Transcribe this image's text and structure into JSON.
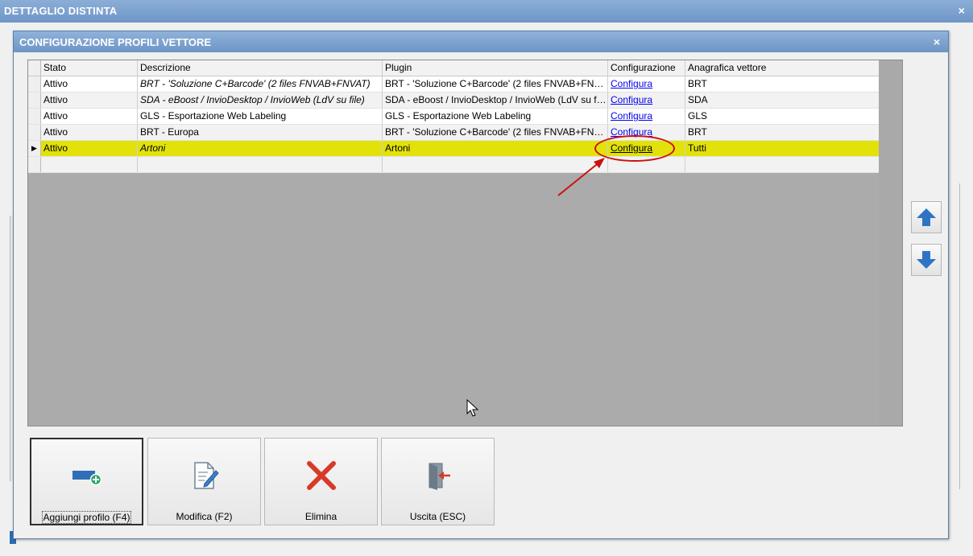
{
  "outer_window": {
    "title": "DETTAGLIO DISTINTA",
    "close_glyph": "×"
  },
  "dialog": {
    "title": "CONFIGURAZIONE PROFILI VETTORE",
    "close_glyph": "×"
  },
  "grid": {
    "columns": [
      "Stato",
      "Descrizione",
      "Plugin",
      "Configurazione",
      "Anagrafica vettore"
    ],
    "rows": [
      {
        "stato": "Attivo",
        "descrizione": "BRT - 'Soluzione C+Barcode' (2 files FNVAB+FNVAT)",
        "plugin": "BRT - 'Soluzione C+Barcode' (2 files FNVAB+FNVAT)",
        "configurazione": "Configura",
        "anagrafica": "BRT",
        "italic": true
      },
      {
        "stato": "Attivo",
        "descrizione": "SDA - eBoost / InvioDesktop / InvioWeb (LdV su file)",
        "plugin": "SDA - eBoost / InvioDesktop / InvioWeb (LdV su file)",
        "configurazione": "Configura",
        "anagrafica": "SDA",
        "italic": true
      },
      {
        "stato": "Attivo",
        "descrizione": "GLS - Esportazione Web Labeling",
        "plugin": "GLS - Esportazione Web Labeling",
        "configurazione": "Configura",
        "anagrafica": "GLS",
        "italic": false
      },
      {
        "stato": "Attivo",
        "descrizione": "BRT - Europa",
        "plugin": "BRT - 'Soluzione C+Barcode' (2 files FNVAB+FNVAT)",
        "configurazione": "Configura",
        "anagrafica": "BRT",
        "italic": false
      },
      {
        "stato": "Attivo",
        "descrizione": "Artoni",
        "plugin": "Artoni",
        "configurazione": "Configura",
        "anagrafica": "Tutti",
        "italic": true,
        "selected": true
      }
    ],
    "row_indicator_glyph": "▶"
  },
  "buttons": {
    "add": "Aggiungi profilo (F4)",
    "edit": "Modifica (F2)",
    "delete": "Elimina",
    "exit": "Uscita (ESC)"
  },
  "colors": {
    "selected_row": "#e2e20a",
    "link": "#0000ee",
    "annotation": "#cc1010",
    "arrow_blue": "#2f74c4",
    "delete_red": "#d73a28"
  },
  "icons": {
    "up": "arrow-up-icon",
    "down": "arrow-down-icon",
    "add": "add-profile-icon",
    "edit": "edit-document-icon",
    "delete": "delete-x-icon",
    "exit": "exit-door-icon"
  }
}
